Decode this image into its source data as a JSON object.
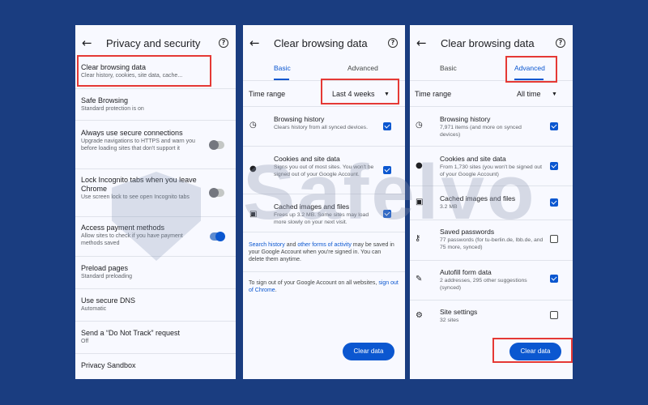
{
  "panel1": {
    "title": "Privacy and security",
    "items": [
      {
        "title": "Clear browsing data",
        "subtitle": "Clear history, cookies, site data, cache..."
      },
      {
        "title": "Safe Browsing",
        "subtitle": "Standard protection is on"
      },
      {
        "title": "Always use secure connections",
        "subtitle": "Upgrade navigations to HTTPS and warn you before loading sites that don't support it",
        "toggle": false
      },
      {
        "title": "Lock Incognito tabs when you leave Chrome",
        "subtitle": "Use screen lock to see open Incognito tabs",
        "toggle": false
      },
      {
        "title": "Access payment methods",
        "subtitle": "Allow sites to check if you have payment methods saved",
        "toggle": true
      },
      {
        "title": "Preload pages",
        "subtitle": "Standard preloading"
      },
      {
        "title": "Use secure DNS",
        "subtitle": "Automatic"
      },
      {
        "title": "Send a “Do Not Track” request",
        "subtitle": "Off"
      },
      {
        "title": "Privacy Sandbox",
        "subtitle": ""
      }
    ]
  },
  "panel2": {
    "title": "Clear browsing data",
    "tabs": [
      "Basic",
      "Advanced"
    ],
    "active_tab": "Basic",
    "time_range_label": "Time range",
    "time_range_value": "Last 4 weeks",
    "items": [
      {
        "title": "Browsing history",
        "subtitle": "Clears history from all synced devices.",
        "icon": "clock-icon",
        "checked": true
      },
      {
        "title": "Cookies and site data",
        "subtitle": "Signs you out of most sites. You won't be signed out of your Google Account.",
        "icon": "cookie-icon",
        "checked": true
      },
      {
        "title": "Cached images and files",
        "subtitle": "Frees up 3.2 MB. Some sites may load more slowly on your next visit.",
        "icon": "image-icon",
        "checked": true
      }
    ],
    "note1_link1": "Search history",
    "note1_mid": " and ",
    "note1_link2": "other forms of activity",
    "note1_rest": " may be saved in your Google Account when you're signed in. You can delete them anytime.",
    "note2_text": "To sign out of your Google Account on all websites, ",
    "note2_link": "sign out of Chrome",
    "note2_end": ".",
    "button": "Clear data"
  },
  "panel3": {
    "title": "Clear browsing data",
    "tabs": [
      "Basic",
      "Advanced"
    ],
    "active_tab": "Advanced",
    "time_range_label": "Time range",
    "time_range_value": "All time",
    "items": [
      {
        "title": "Browsing history",
        "subtitle": "7,971 items (and more on synced devices)",
        "icon": "clock-icon",
        "checked": true
      },
      {
        "title": "Cookies and site data",
        "subtitle": "From 1,730 sites (you won't be signed out of your Google Account)",
        "icon": "cookie-icon",
        "checked": true
      },
      {
        "title": "Cached images and files",
        "subtitle": "3.2 MB",
        "icon": "image-icon",
        "checked": true
      },
      {
        "title": "Saved passwords",
        "subtitle": "77 passwords (for tu-berlin.de, lbb.de, and 75 more, synced)",
        "icon": "key-icon",
        "checked": false
      },
      {
        "title": "Autofill form data",
        "subtitle": "2 addresses, 295 other suggestions (synced)",
        "icon": "pencil-icon",
        "checked": true
      },
      {
        "title": "Site settings",
        "subtitle": "32 sites",
        "icon": "settings-icon",
        "checked": false
      }
    ],
    "button": "Clear data"
  },
  "watermark": "Safelvo",
  "colors": {
    "accent": "#0b57d0",
    "highlight": "#e53935",
    "background": "#1a3d80"
  }
}
